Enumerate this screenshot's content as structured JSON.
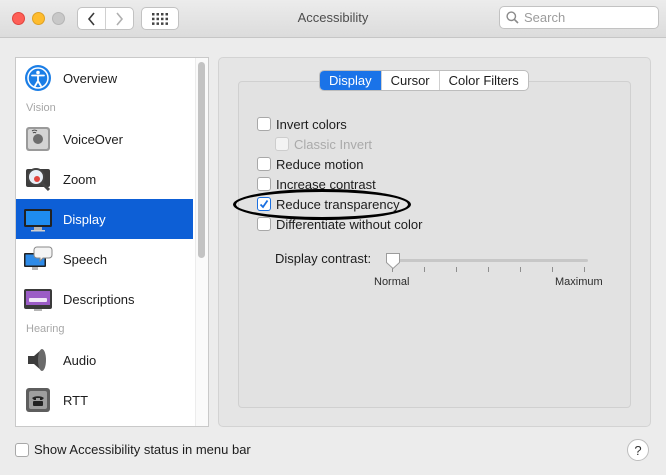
{
  "window": {
    "title": "Accessibility"
  },
  "search": {
    "placeholder": "Search"
  },
  "sidebar": {
    "items": [
      {
        "label": "Overview",
        "icon": "accessibility-icon"
      },
      {
        "group": "Vision"
      },
      {
        "label": "VoiceOver",
        "icon": "voiceover-icon"
      },
      {
        "label": "Zoom",
        "icon": "zoom-icon"
      },
      {
        "label": "Display",
        "icon": "display-icon",
        "selected": true
      },
      {
        "label": "Speech",
        "icon": "speech-icon"
      },
      {
        "label": "Descriptions",
        "icon": "descriptions-icon"
      },
      {
        "group": "Hearing"
      },
      {
        "label": "Audio",
        "icon": "audio-icon"
      },
      {
        "label": "RTT",
        "icon": "rtt-icon"
      }
    ]
  },
  "tabs": [
    {
      "label": "Display",
      "active": true
    },
    {
      "label": "Cursor",
      "active": false
    },
    {
      "label": "Color Filters",
      "active": false
    }
  ],
  "options": [
    {
      "label": "Invert colors",
      "checked": false,
      "enabled": true
    },
    {
      "label": "Classic Invert",
      "checked": false,
      "enabled": false
    },
    {
      "label": "Reduce motion",
      "checked": false,
      "enabled": true
    },
    {
      "label": "Increase contrast",
      "checked": false,
      "enabled": true
    },
    {
      "label": "Reduce transparency",
      "checked": true,
      "enabled": true
    },
    {
      "label": "Differentiate without color",
      "checked": false,
      "enabled": true
    }
  ],
  "contrast": {
    "label": "Display contrast:",
    "min_label": "Normal",
    "max_label": "Maximum",
    "value": 0
  },
  "footer": {
    "status_label": "Show Accessibility status in menu bar",
    "help": "?"
  },
  "colors": {
    "accent": "#0d5fd6",
    "tab_active": "#1a73e8"
  }
}
